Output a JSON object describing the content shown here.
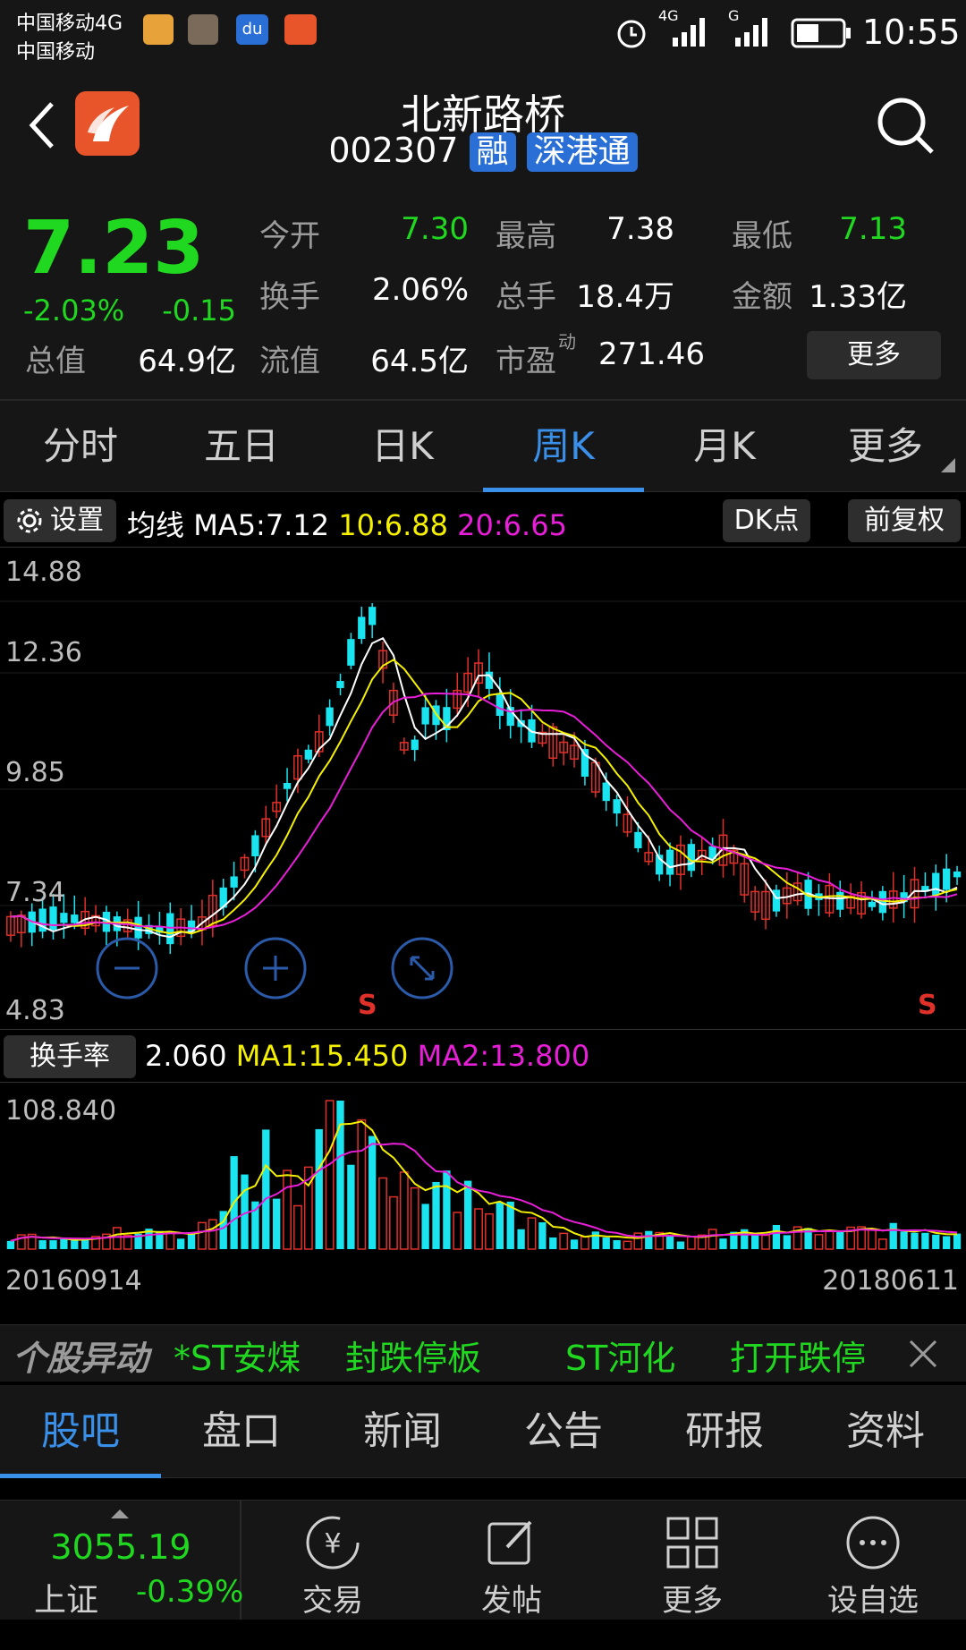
{
  "status_bar": {
    "carrier_line1": "中国移动4G",
    "carrier_line2": "中国移动",
    "time": "10:55",
    "net1": "4G",
    "net2": "G"
  },
  "header": {
    "title": "北新路桥",
    "code": "002307",
    "badge1": "融",
    "badge2": "深港通"
  },
  "quote": {
    "price": "7.23",
    "change_pct": "-2.03%",
    "change": "-0.15",
    "rows": [
      [
        {
          "label": "今开",
          "value": "7.30",
          "color": "green"
        },
        {
          "label": "最高",
          "value": "7.38",
          "color": "white"
        },
        {
          "label": "最低",
          "value": "7.13",
          "color": "green"
        }
      ],
      [
        {
          "label": "换手",
          "value": "2.06%",
          "color": "white"
        },
        {
          "label": "总手",
          "value": "18.4万",
          "color": "white"
        },
        {
          "label": "金额",
          "value": "1.33亿",
          "color": "white"
        }
      ]
    ],
    "total_value_label": "总值",
    "total_value": "64.9亿",
    "float_value_label": "流值",
    "float_value": "64.5亿",
    "pe_label": "市盈",
    "pe_sup": "动",
    "pe_value": "271.46",
    "more_button": "更多"
  },
  "tabs": [
    "分时",
    "五日",
    "日K",
    "周K",
    "月K",
    "更多"
  ],
  "active_tab": "周K",
  "ma_bar": {
    "settings_label": "设置",
    "ma_label": "均线",
    "ma5": "MA5:7.12",
    "ma10": "10:6.88",
    "ma20": "20:6.65",
    "dk_button": "DK点",
    "adjust_button": "前复权"
  },
  "kchart": {
    "y_labels": [
      "14.88",
      "12.36",
      "9.85",
      "7.34",
      "4.83"
    ],
    "signal_label": "S"
  },
  "volume": {
    "label": "换手率",
    "value": "2.060",
    "ma1": "MA1:15.450",
    "ma2": "MA2:13.800",
    "max_label": "108.840"
  },
  "dates": {
    "start": "20160914",
    "end": "20180611"
  },
  "ticker": {
    "title": "个股异动",
    "items": [
      "*ST安煤",
      "封跌停板",
      "ST河化",
      "打开跌停"
    ]
  },
  "bottom_tabs": [
    "股吧",
    "盘口",
    "新闻",
    "公告",
    "研报",
    "资料"
  ],
  "active_bottom_tab": "股吧",
  "index": {
    "value": "3055.19",
    "name": "上证",
    "change": "-0.39%"
  },
  "bottom_nav": [
    "交易",
    "发帖",
    "更多",
    "设自选"
  ],
  "colors": {
    "up": "#e0302a",
    "down": "#19e4f0",
    "ma5": "#ffffff",
    "ma10": "#f5f000",
    "ma20": "#e81ed8",
    "green": "#21d821",
    "accent": "#3a8fe8"
  }
}
